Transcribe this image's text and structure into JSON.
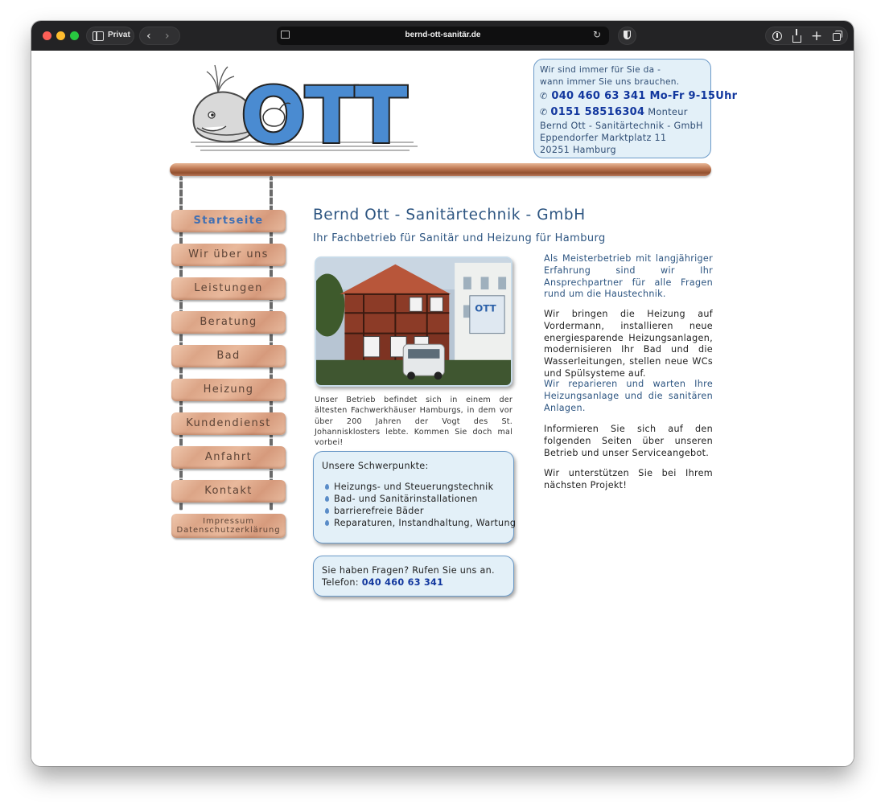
{
  "browser": {
    "private_label": "Privat",
    "url": "bernd-ott-sanitär.de"
  },
  "logo": {
    "alt_text": "OTT"
  },
  "contact": {
    "line1": "Wir sind immer für Sie da -",
    "line2": "wann immer Sie uns brauchen.",
    "phone_main": "040 460 63 341",
    "phone_main_hours": "Mo-Fr 9-15Uhr",
    "phone_mobile": "0151 58516304",
    "phone_mobile_role": "Monteur",
    "company": "Bernd Ott - Sanitärtechnik - GmbH",
    "street": "Eppendorfer Marktplatz 11",
    "city": "20251 Hamburg"
  },
  "nav": {
    "items": [
      {
        "label": "Startseite"
      },
      {
        "label": "Wir über uns"
      },
      {
        "label": "Leistungen"
      },
      {
        "label": "Beratung"
      },
      {
        "label": "Bad"
      },
      {
        "label": "Heizung"
      },
      {
        "label": "Kundendienst"
      },
      {
        "label": "Anfahrt"
      },
      {
        "label": "Kontakt"
      },
      {
        "label": "Impressum",
        "label2": "Datenschutzerklärung"
      }
    ]
  },
  "main": {
    "title": "Bernd Ott - Sanitärtechnik - GmbH",
    "subtitle": "Ihr Fachbetrieb für Sanitär und Heizung für Hamburg",
    "photo_sign": "OTT",
    "caption": "Unser Betrieb befindet sich in einem der ältesten Fachwerkhäuser Hamburgs, in dem vor über 200 Jahren der Vogt des St. Johannisklosters lebte. Kommen Sie doch mal vorbei!",
    "focus": {
      "title": "Unsere Schwerpunkte:",
      "items": [
        "Heizungs- und Steuerungstechnik",
        "Bad- und Sanitärinstallationen",
        "barrierefreie Bäder",
        "Reparaturen, Instandhaltung, Wartung"
      ]
    },
    "questions": {
      "line1": "Sie haben Fragen? Rufen Sie uns an.",
      "phone_label": "Telefon:",
      "phone": "040 460 63 341"
    }
  },
  "right": {
    "p1": "Als Meisterbetrieb mit langjähriger Erfahrung sind wir Ihr Ansprechpartner für alle Fragen rund um die Haustechnik.",
    "p2": "Wir bringen die Heizung auf Vordermann, installieren neue energiesparende Heizungsanlagen, modernisieren Ihr Bad und die Wasserleitungen, stellen neue WCs und Spülsysteme auf.",
    "p3": "Wir reparieren und warten Ihre Heizungsanlage und die sanitären Anlagen.",
    "p4": "Informieren Sie sich auf den folgenden Seiten über unseren Betrieb und unser Serviceangebot.",
    "p5": "Wir unterstützen Sie bei Ihrem nächsten Projekt!"
  }
}
